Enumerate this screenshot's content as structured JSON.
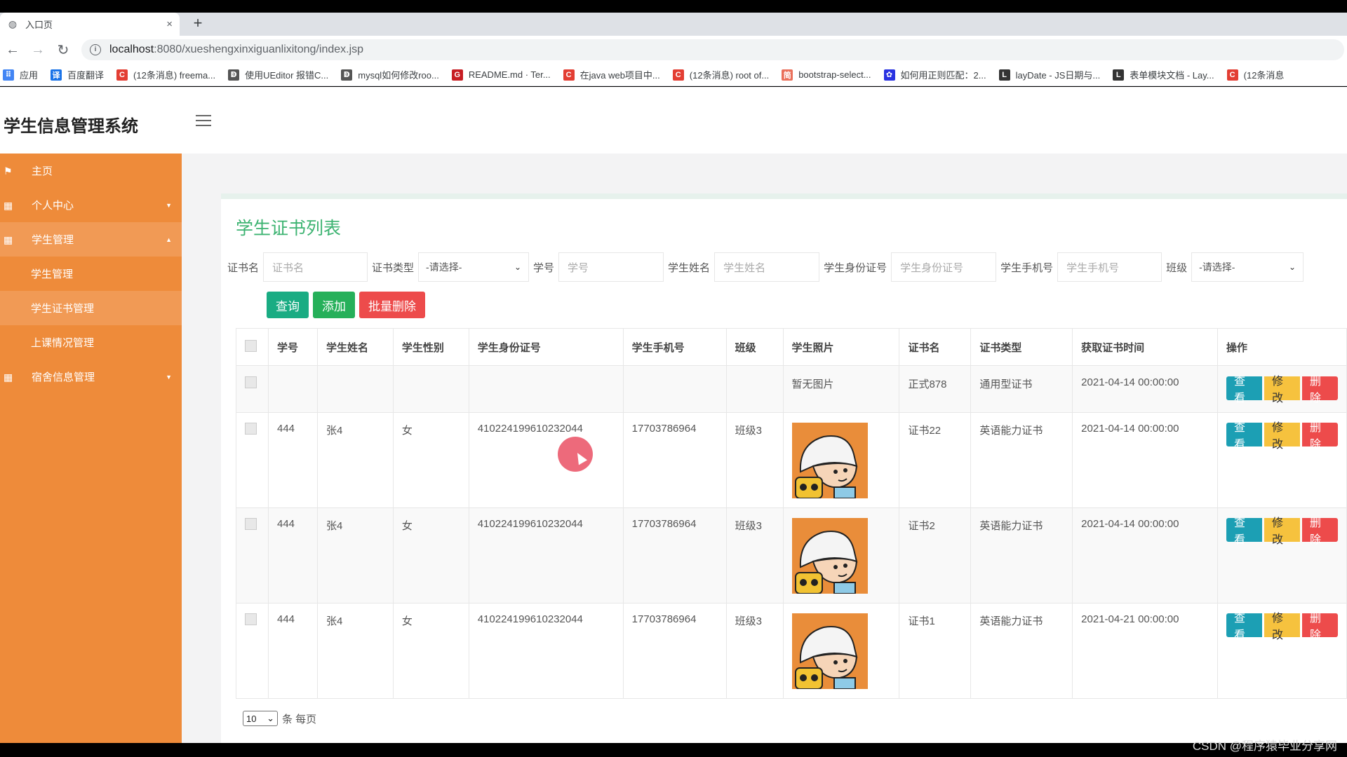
{
  "browser": {
    "tab_title": "入口页",
    "tab_close": "×",
    "new_tab": "+",
    "url_host": "localhost",
    "url_path": ":8080/xueshengxinxiguanlixitong/index.jsp",
    "bookmarks": [
      {
        "icon": "apps-icon",
        "color": "#4285f4",
        "label": "应用"
      },
      {
        "icon": "translate-icon",
        "color": "#1a73e8",
        "label": "百度翻译"
      },
      {
        "icon": "csdn-icon",
        "color": "#e33e33",
        "label": "(12条消息) freema..."
      },
      {
        "icon": "yuque-icon",
        "color": "#555555",
        "label": "使用UEditor 报错C..."
      },
      {
        "icon": "yuque-icon",
        "color": "#555555",
        "label": "mysql如何修改roo..."
      },
      {
        "icon": "gitee-icon",
        "color": "#c71d23",
        "label": "README.md · Ter..."
      },
      {
        "icon": "csdn-icon",
        "color": "#e33e33",
        "label": "在java web项目中..."
      },
      {
        "icon": "csdn-icon",
        "color": "#e33e33",
        "label": "(12条消息) root of..."
      },
      {
        "icon": "jianshu-icon",
        "color": "#ea6f5a",
        "label": "bootstrap-select..."
      },
      {
        "icon": "baidu-icon",
        "color": "#2932e1",
        "label": "如何用正则匹配：2..."
      },
      {
        "icon": "layui-icon",
        "color": "#333333",
        "label": "layDate - JS日期与..."
      },
      {
        "icon": "layui-icon",
        "color": "#333333",
        "label": "表单模块文档 - Lay..."
      },
      {
        "icon": "csdn-icon",
        "color": "#e33e33",
        "label": "(12条消息"
      }
    ]
  },
  "app": {
    "brand": "学生信息管理系统",
    "sidebar": {
      "items": [
        {
          "label": "主页",
          "icon": "flag-icon",
          "arrow": ""
        },
        {
          "label": "个人中心",
          "icon": "grid-icon",
          "arrow": "▼"
        },
        {
          "label": "学生管理",
          "icon": "grid-icon",
          "arrow": "▲"
        }
      ],
      "subitems": [
        "学生管理",
        "学生证书管理",
        "上课情况管理"
      ],
      "last_item": {
        "label": "宿舍信息管理",
        "icon": "grid-icon",
        "arrow": "▼"
      }
    },
    "page_title": "学生证书列表",
    "filters": {
      "cert_name_label": "证书名",
      "cert_name_placeholder": "证书名",
      "cert_type_label": "证书类型",
      "cert_type_value": "-请选择-",
      "student_no_label": "学号",
      "student_no_placeholder": "学号",
      "student_name_label": "学生姓名",
      "student_name_placeholder": "学生姓名",
      "id_card_label": "学生身份证号",
      "id_card_placeholder": "学生身份证号",
      "phone_label": "学生手机号",
      "phone_placeholder": "学生手机号",
      "class_label": "班级",
      "class_value": "-请选择-"
    },
    "actions": {
      "query": "查询",
      "add": "添加",
      "batch_delete": "批量删除"
    },
    "table": {
      "headers": [
        "学号",
        "学生姓名",
        "学生性别",
        "学生身份证号",
        "学生手机号",
        "班级",
        "学生照片",
        "证书名",
        "证书类型",
        "获取证书时间",
        "操作"
      ],
      "rows": [
        {
          "no": "",
          "name": "",
          "gender": "",
          "id_card": "",
          "phone": "",
          "class": "",
          "photo_text": "暂无图片",
          "cert_name": "正式878",
          "cert_type": "通用型证书",
          "time": "2021-04-14 00:00:00"
        },
        {
          "no": "444",
          "name": "张4",
          "gender": "女",
          "id_card": "410224199610232044",
          "phone": "17703786964",
          "class": "班级3",
          "photo_text": "",
          "cert_name": "证书22",
          "cert_type": "英语能力证书",
          "time": "2021-04-14 00:00:00"
        },
        {
          "no": "444",
          "name": "张4",
          "gender": "女",
          "id_card": "410224199610232044",
          "phone": "17703786964",
          "class": "班级3",
          "photo_text": "",
          "cert_name": "证书2",
          "cert_type": "英语能力证书",
          "time": "2021-04-14 00:00:00"
        },
        {
          "no": "444",
          "name": "张4",
          "gender": "女",
          "id_card": "410224199610232044",
          "phone": "17703786964",
          "class": "班级3",
          "photo_text": "",
          "cert_name": "证书1",
          "cert_type": "英语能力证书",
          "time": "2021-04-21 00:00:00"
        }
      ],
      "row_actions": {
        "view": "查看",
        "edit": "修改",
        "delete": "删除"
      }
    },
    "pager": {
      "page_size": "10",
      "suffix": "条 每页"
    }
  },
  "watermark": "CSDN @程序猿毕业分享网"
}
